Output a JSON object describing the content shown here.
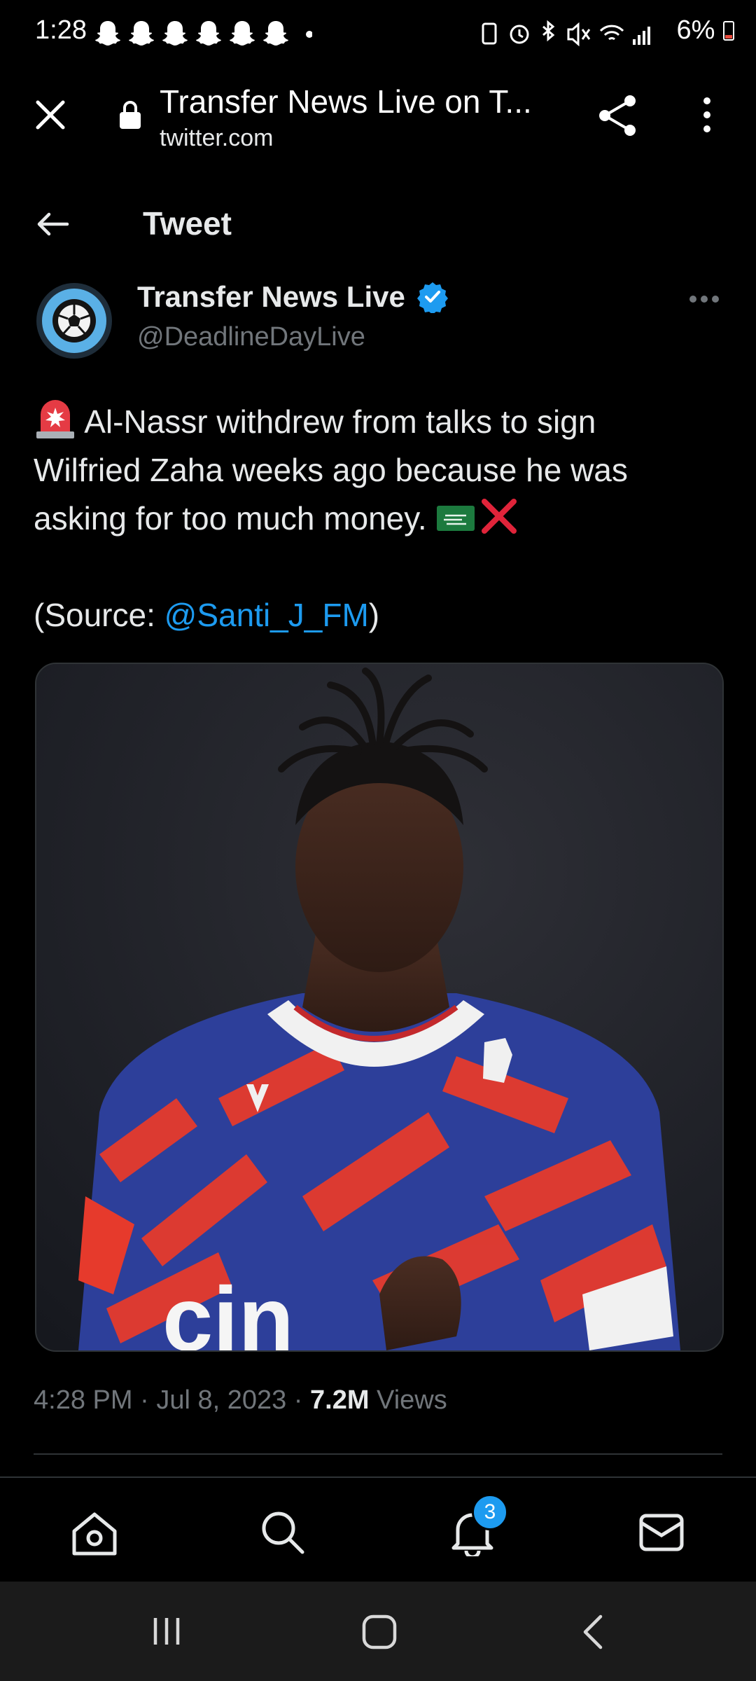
{
  "status_bar": {
    "time": "1:28",
    "battery": "6%",
    "icons": [
      "snapchat-icon",
      "snapchat-icon",
      "snapchat-icon",
      "snapchat-icon",
      "snapchat-icon",
      "snapchat-icon",
      "dot-icon",
      "battery-saver-icon",
      "alarm-icon",
      "bluetooth-icon",
      "mute-icon",
      "wifi-icon",
      "signal-icon",
      "battery-icon"
    ]
  },
  "browser": {
    "title": "Transfer News Live on T...",
    "domain": "twitter.com"
  },
  "header": {
    "title": "Tweet"
  },
  "tweet": {
    "author_name": "Transfer News Live",
    "author_handle": "@DeadlineDayLive",
    "text_line1": " Al-Nassr withdrew from talks to sign",
    "text_line2": "Wilfried Zaha weeks ago because he was",
    "text_line3": "asking for too much money. ",
    "source_prefix": "(Source: ",
    "source_mention": "@Santi_J_FM",
    "source_suffix": ")",
    "time": "4:28 PM",
    "sep1": " · ",
    "date": "Jul 8, 2023",
    "sep2": " · ",
    "views_count": "7.2M",
    "views_label": " Views"
  },
  "nav": {
    "notification_count": "3"
  },
  "colors": {
    "accent": "#1d9bf0",
    "background": "#000000",
    "muted": "#71767b"
  }
}
